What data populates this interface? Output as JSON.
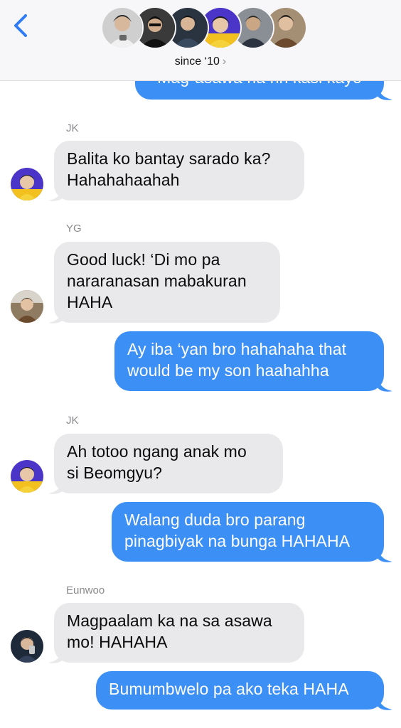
{
  "header": {
    "group_name": "since ‘10",
    "chevron": "›",
    "member_count": 6
  },
  "messages": [
    {
      "id": "m0",
      "direction": "out",
      "text": "Mag-asawa na rin kasi kayo"
    },
    {
      "id": "m1",
      "direction": "in",
      "sender": "JK",
      "text": "Balita ko bantay sarado ka?\nHahahahaahah"
    },
    {
      "id": "m2",
      "direction": "in",
      "sender": "YG",
      "text": "Good luck! ‘Di mo pa\nnararanasan mabakuran\nHAHA"
    },
    {
      "id": "m3",
      "direction": "out",
      "text": "Ay iba ‘yan bro hahahaha that\nwould be my son haahahha"
    },
    {
      "id": "m4",
      "direction": "in",
      "sender": "JK",
      "text": "Ah totoo ngang anak mo\nsi Beomgyu?"
    },
    {
      "id": "m5",
      "direction": "out",
      "text": "Walang duda bro parang\npinagbiyak na bunga HAHAHA"
    },
    {
      "id": "m6",
      "direction": "in",
      "sender": "Eunwoo",
      "text": "Magpaalam ka na sa asawa\nmo! HAHAHA"
    },
    {
      "id": "m7",
      "direction": "out",
      "text": "Bumumbwelo pa ako teka HAHA"
    }
  ],
  "colors": {
    "outgoing_bubble": "#3b8ff5",
    "incoming_bubble": "#e9e9eb",
    "accent": "#2f7cf6",
    "header_bg": "#f7f7f9"
  },
  "icons": {
    "back": "chevron-left-icon"
  }
}
